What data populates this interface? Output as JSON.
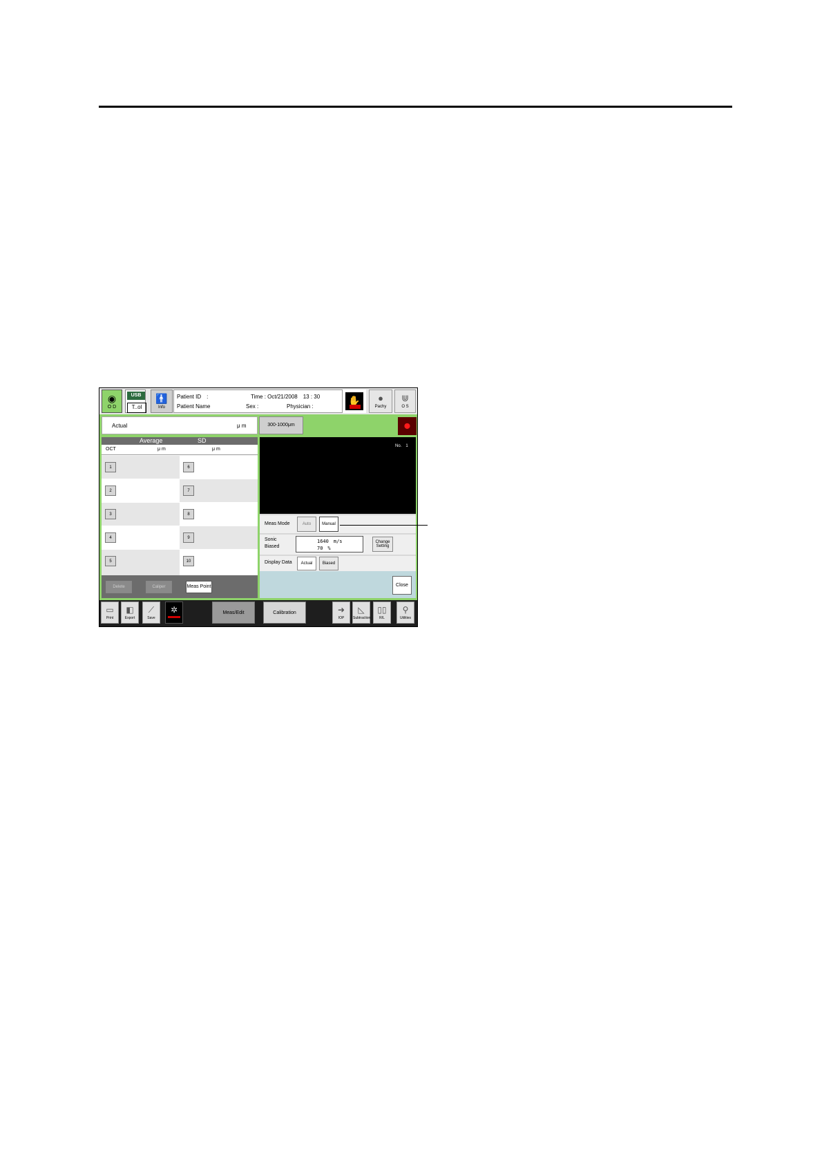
{
  "top_bar": {
    "od_label": "O D",
    "usb_label": "USB",
    "tx_label": "T..ol",
    "info_label": "Info",
    "patient_id_label": "Patient ID　:",
    "patient_name_label": "Patient Name",
    "time_label": "Time : Oct/21/2008　13 : 30",
    "sex_label": "Sex :",
    "physician_label": "Physician :",
    "pachy_label": "Pachy",
    "os_label": "O S"
  },
  "measure": {
    "actual_label": "Actual",
    "actual_unit": "μ m",
    "range_button": "300-1000μm"
  },
  "table": {
    "header_average": "Average",
    "header_sd": "SD",
    "col_label": "OCT",
    "unit_avg": "μ m",
    "unit_sd": "μ m",
    "left_numbers": [
      "1",
      "2",
      "3",
      "4",
      "5"
    ],
    "right_numbers": [
      "6",
      "7",
      "8",
      "9",
      "10"
    ],
    "delete_button": "Delete",
    "caliper_button": "Caliper",
    "meas_point_button": "Meas Point"
  },
  "viewer": {
    "image_number": "No.　1"
  },
  "controls": {
    "meas_mode_label": "Meas Mode",
    "auto_button": "Auto",
    "manual_button": "Manual",
    "sonic_label": "Sonic",
    "biased_label": "Biased",
    "sonic_value": "1640　m/s",
    "biased_value": "70　%",
    "change_setting_line1": "Change",
    "change_setting_line2": "Setting",
    "display_data_label": "Display Data",
    "display_actual_button": "Actual",
    "display_biased_button": "Biased",
    "close_button": "Close"
  },
  "bottom_bar": {
    "print_label": "Print",
    "export_label": "Export",
    "save_label": "Save",
    "meas_edit_button": "Meas/Edit",
    "calibration_button": "Calibration",
    "iop_label": "IOP",
    "subtraction_label": "Subtraction",
    "rl_label": "R/L",
    "utilities_label": "Utilities"
  },
  "colors": {
    "green": "#8ed36a",
    "dark_gray": "#6c6c6c",
    "light_blue": "#bfd8dd",
    "alert_red": "#d00000"
  }
}
